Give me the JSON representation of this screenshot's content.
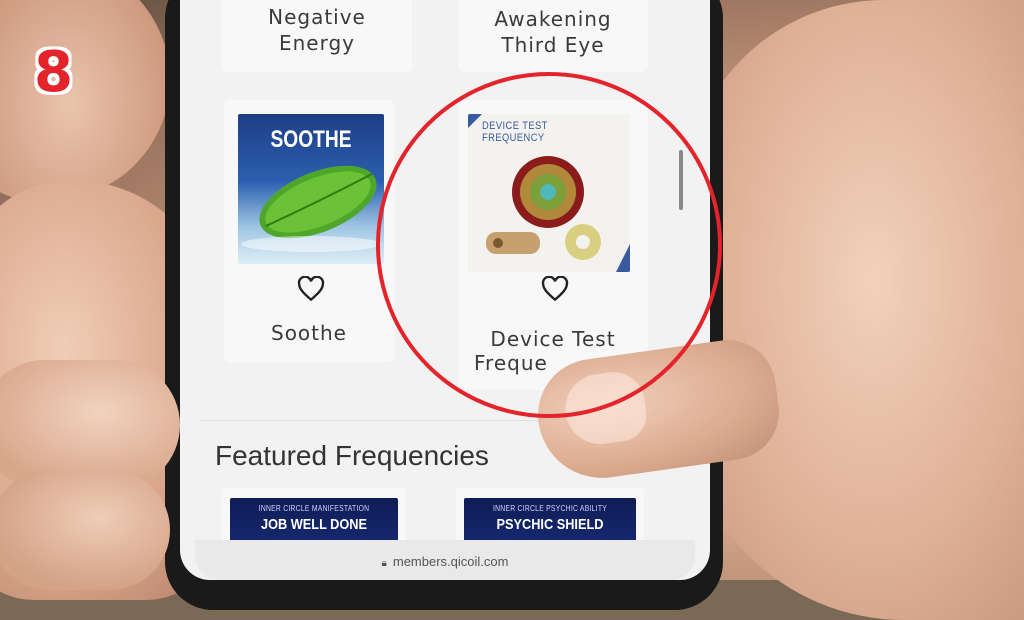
{
  "badge": {
    "number": "8"
  },
  "grid": {
    "top_row": [
      {
        "title_line1": "Negative",
        "title_line2": "Energy"
      },
      {
        "title_line1": "Awakening",
        "title_line2": "Third Eye"
      }
    ],
    "items": [
      {
        "title": "Soothe",
        "image_text": "SOOTHE",
        "favorite_icon": "heart-outline-icon"
      },
      {
        "title_line1": "Device Test",
        "title_line2": "Freque",
        "image_text": "DEVICE TEST FREQUENCY",
        "favorite_icon": "heart-outline-icon"
      }
    ]
  },
  "featured": {
    "section_title": "Featured Frequencies",
    "items": [
      {
        "small": "INNER CIRCLE MANIFESTATION",
        "big": "JOB WELL DONE"
      },
      {
        "small": "INNER CIRCLE PSYCHIC ABILITY",
        "big": "PSYCHIC SHIELD"
      }
    ]
  },
  "browser": {
    "url": "members.qicoil.com",
    "lock_icon": "lock-icon"
  },
  "colors": {
    "highlight_circle": "#e4232a",
    "badge": "#e4232a"
  }
}
